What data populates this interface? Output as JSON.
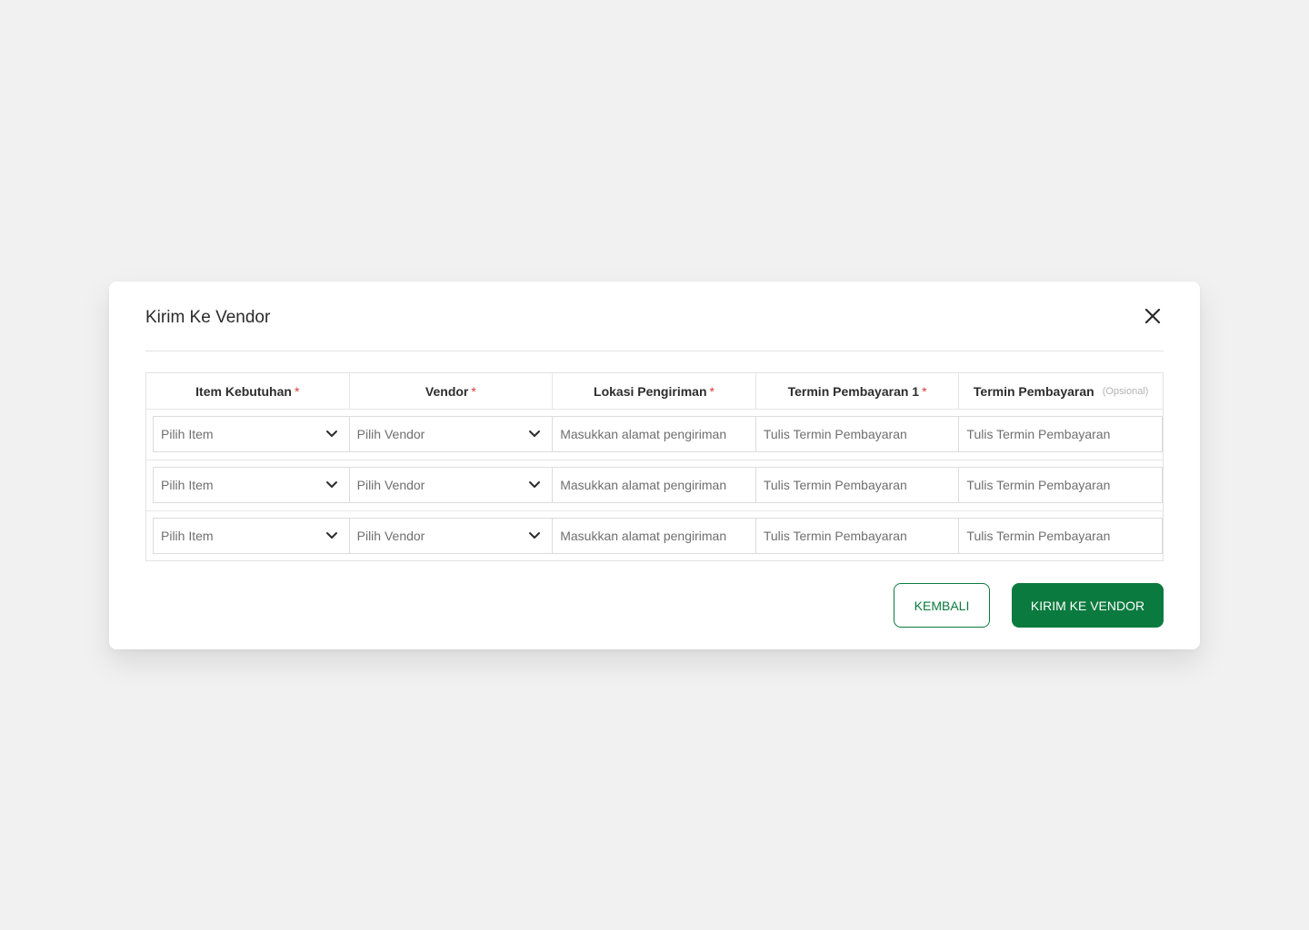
{
  "modal": {
    "title": "Kirim Ke Vendor"
  },
  "table": {
    "columns": [
      {
        "label": "Item Kebutuhan",
        "required_mark": "*"
      },
      {
        "label": "Vendor",
        "required_mark": "*"
      },
      {
        "label": "Lokasi Pengiriman",
        "required_mark": "*"
      },
      {
        "label": "Termin Pembayaran 1",
        "required_mark": "*"
      },
      {
        "label": "Termin Pembayaran",
        "optional_note": "(Opsional)"
      }
    ],
    "rows": [
      {
        "item": "Pilih Item",
        "vendor": "Pilih Vendor",
        "lokasi": "Masukkan alamat pengiriman",
        "termin1": "Tulis Termin Pembayaran",
        "termin2": "Tulis Termin Pembayaran"
      },
      {
        "item": "Pilih Item",
        "vendor": "Pilih Vendor",
        "lokasi": "Masukkan alamat pengiriman",
        "termin1": "Tulis Termin Pembayaran",
        "termin2": "Tulis Termin Pembayaran"
      },
      {
        "item": "Pilih Item",
        "vendor": "Pilih Vendor",
        "lokasi": "Masukkan alamat pengiriman",
        "termin1": "Tulis Termin Pembayaran",
        "termin2": "Tulis Termin Pembayaran"
      }
    ]
  },
  "buttons": {
    "back_label": "KEMBALI",
    "send_label": "KIRIM KE VENDOR"
  },
  "icons": {
    "close": "close-icon",
    "dropdown": "chevron-down-icon"
  },
  "colors": {
    "primary": "#0b7a3e",
    "required": "#d93a3a",
    "background": "#f1f1f1"
  }
}
